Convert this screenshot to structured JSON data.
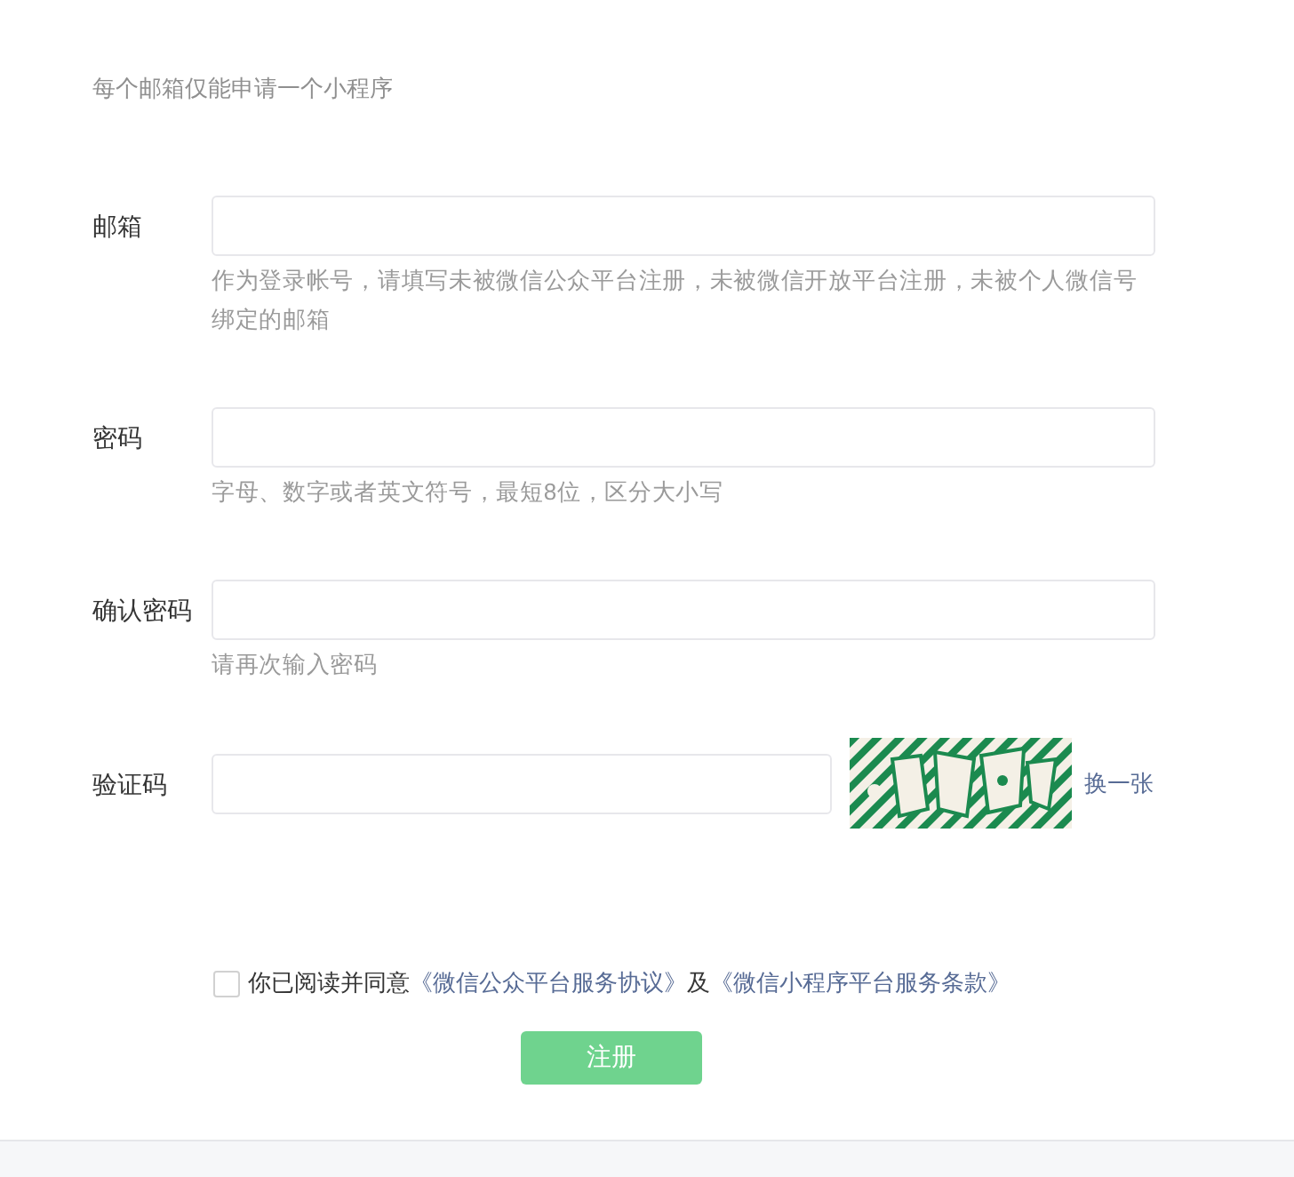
{
  "notice": "每个邮箱仅能申请一个小程序",
  "fields": [
    {
      "kind": "input",
      "label": "邮箱",
      "hint": "作为登录帐号，请填写未被微信公众平台注册，未被微信开放平台注册，未被个人微信号绑定的邮箱"
    },
    {
      "kind": "input",
      "label": "密码",
      "hint": "字母、数字或者英文符号，最短8位，区分大小写"
    },
    {
      "kind": "input",
      "label": "确认密码",
      "hint": "请再次输入密码"
    },
    {
      "kind": "captcha",
      "label": "验证码",
      "refresh_link": "换一张"
    }
  ],
  "agreement": {
    "checked": false,
    "parts": [
      {
        "kind": "text",
        "text": "你已阅读并同意"
      },
      {
        "kind": "link",
        "text": "《微信公众平台服务协议》"
      },
      {
        "kind": "text",
        "text": "及"
      },
      {
        "kind": "link",
        "text": "《微信小程序平台服务条款》"
      }
    ]
  },
  "submit_button": {
    "label": "注册",
    "disabled": true
  }
}
